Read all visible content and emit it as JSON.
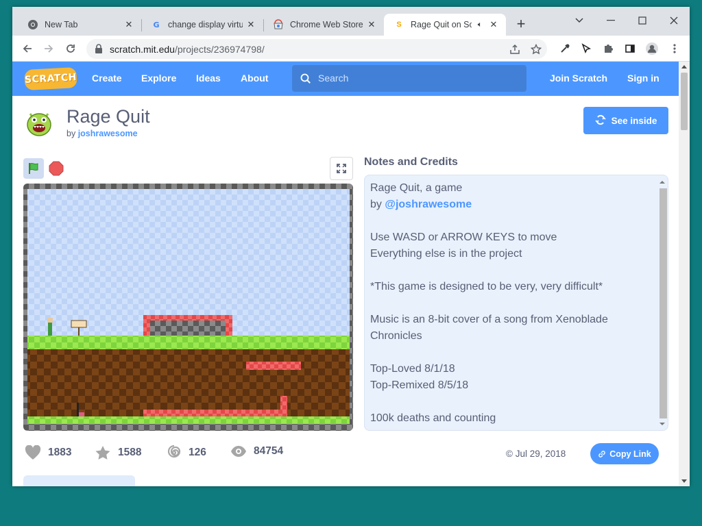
{
  "browser": {
    "tabs": [
      {
        "title": "New Tab",
        "icon": "chrome-icon"
      },
      {
        "title": "change display virtua",
        "icon": "google-icon"
      },
      {
        "title": "Chrome Web Store -",
        "icon": "chrome-web-store-icon"
      },
      {
        "title": "Rage Quit on Scr",
        "icon": "scratch-icon",
        "active": true,
        "audio": true
      }
    ],
    "url": {
      "host": "scratch.mit.edu",
      "path": "/projects/236974798/"
    }
  },
  "nav": {
    "logo": "SCRATCH",
    "links": [
      "Create",
      "Explore",
      "Ideas",
      "About"
    ],
    "search_placeholder": "Search",
    "join": "Join Scratch",
    "signin": "Sign in"
  },
  "project": {
    "title": "Rage Quit",
    "by": "by",
    "author": "joshrawesome",
    "see_inside": "See inside"
  },
  "notes": {
    "title": "Notes and Credits",
    "line1": "Rage Quit, a game",
    "line2_prefix": "by ",
    "line2_link": "@joshrawesome",
    "line3": "Use WASD or ARROW KEYS to move",
    "line4": "Everything else is in the project",
    "line5": "*This game is designed to be very, very difficult*",
    "line6": "Music is an 8-bit cover of a song from Xenoblade Chronicles",
    "line7": "Top-Loved 8/1/18",
    "line8": "Top-Remixed 8/5/18",
    "line9": "100k deaths and counting"
  },
  "stats": {
    "loves": "1883",
    "favorites": "1588",
    "remixes": "126",
    "views": "84754"
  },
  "date": "© Jul 29, 2018",
  "copy_link": "Copy Link",
  "colors": {
    "scratch_blue": "#4c97ff",
    "text": "#575e75",
    "notes_bg": "#e9f1fc",
    "desktop": "#0e7c7e"
  }
}
